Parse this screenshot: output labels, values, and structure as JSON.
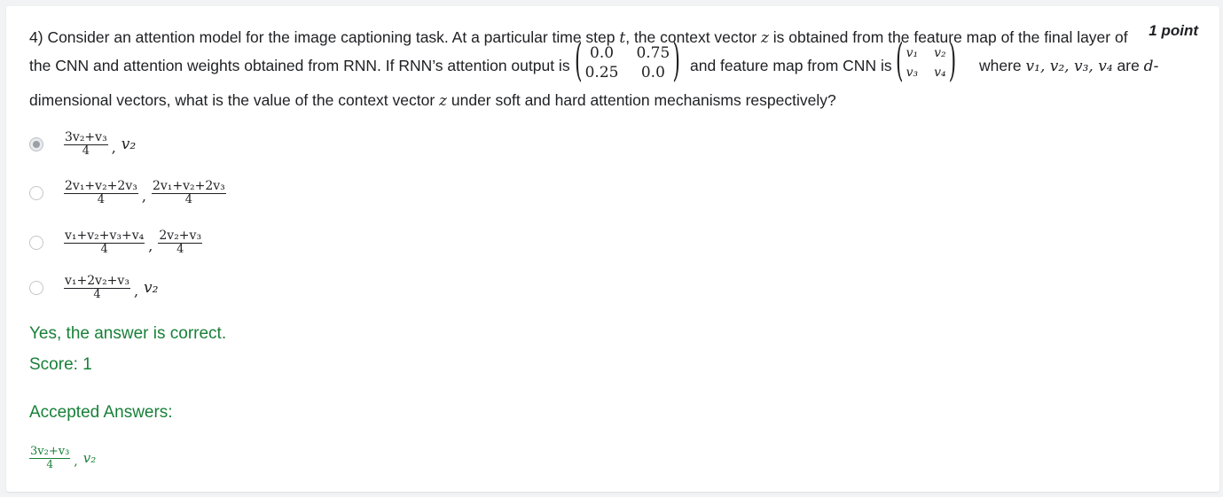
{
  "question": {
    "number_prefix": "4) ",
    "line1_text": "Consider an attention model for the image captioning task. At a particular time step ",
    "var_t": "t",
    "line1_text_b": ", the context vector ",
    "var_z": "z",
    "line1_text_c": " is obtained from the feature map of the final layer of",
    "points": "1 point",
    "line2_a": "the CNN and attention weights obtained from RNN. If RNN’s attention output is",
    "line2_b": "and feature map from CNN is",
    "line2_c": "where ",
    "vars_list": "v₁, v₂, v₃, v₄",
    "line2_d": " are ",
    "var_d": "d",
    "line2_e": "-",
    "line3_a": "dimensional vectors, what is the value of the context vector ",
    "line3_b": " under soft and hard attention mechanisms respectively?",
    "attention_matrix": [
      "0.0",
      "0.75",
      "0.25",
      "0.0"
    ],
    "feature_matrix": [
      "v₁",
      "v₂",
      "v₃",
      "v₄"
    ]
  },
  "options": [
    {
      "numerator": "3v₂+v₃",
      "denominator": "4",
      "second": "v₂",
      "second_is_frac": false,
      "selected": true
    },
    {
      "numerator": "2v₁+v₂+2v₃",
      "denominator": "4",
      "second_num": "2v₁+v₂+2v₃",
      "second_den": "4",
      "second_is_frac": true,
      "selected": false
    },
    {
      "numerator": "v₁+v₂+v₃+v₄",
      "denominator": "4",
      "second_num": "2v₂+v₃",
      "second_den": "4",
      "second_is_frac": true,
      "selected": false
    },
    {
      "numerator": "v₁+2v₂+v₃",
      "denominator": "4",
      "second": "v₂",
      "second_is_frac": false,
      "selected": false
    }
  ],
  "comma": ",",
  "feedback": {
    "result": "Yes, the answer is correct.",
    "score": "Score: 1",
    "accepted_label": "Accepted Answers:",
    "accepted_numerator": "3v₂+v₃",
    "accepted_denominator": "4",
    "accepted_second": "v₂"
  },
  "colors": {
    "correct": "#188038",
    "text": "#202124"
  }
}
